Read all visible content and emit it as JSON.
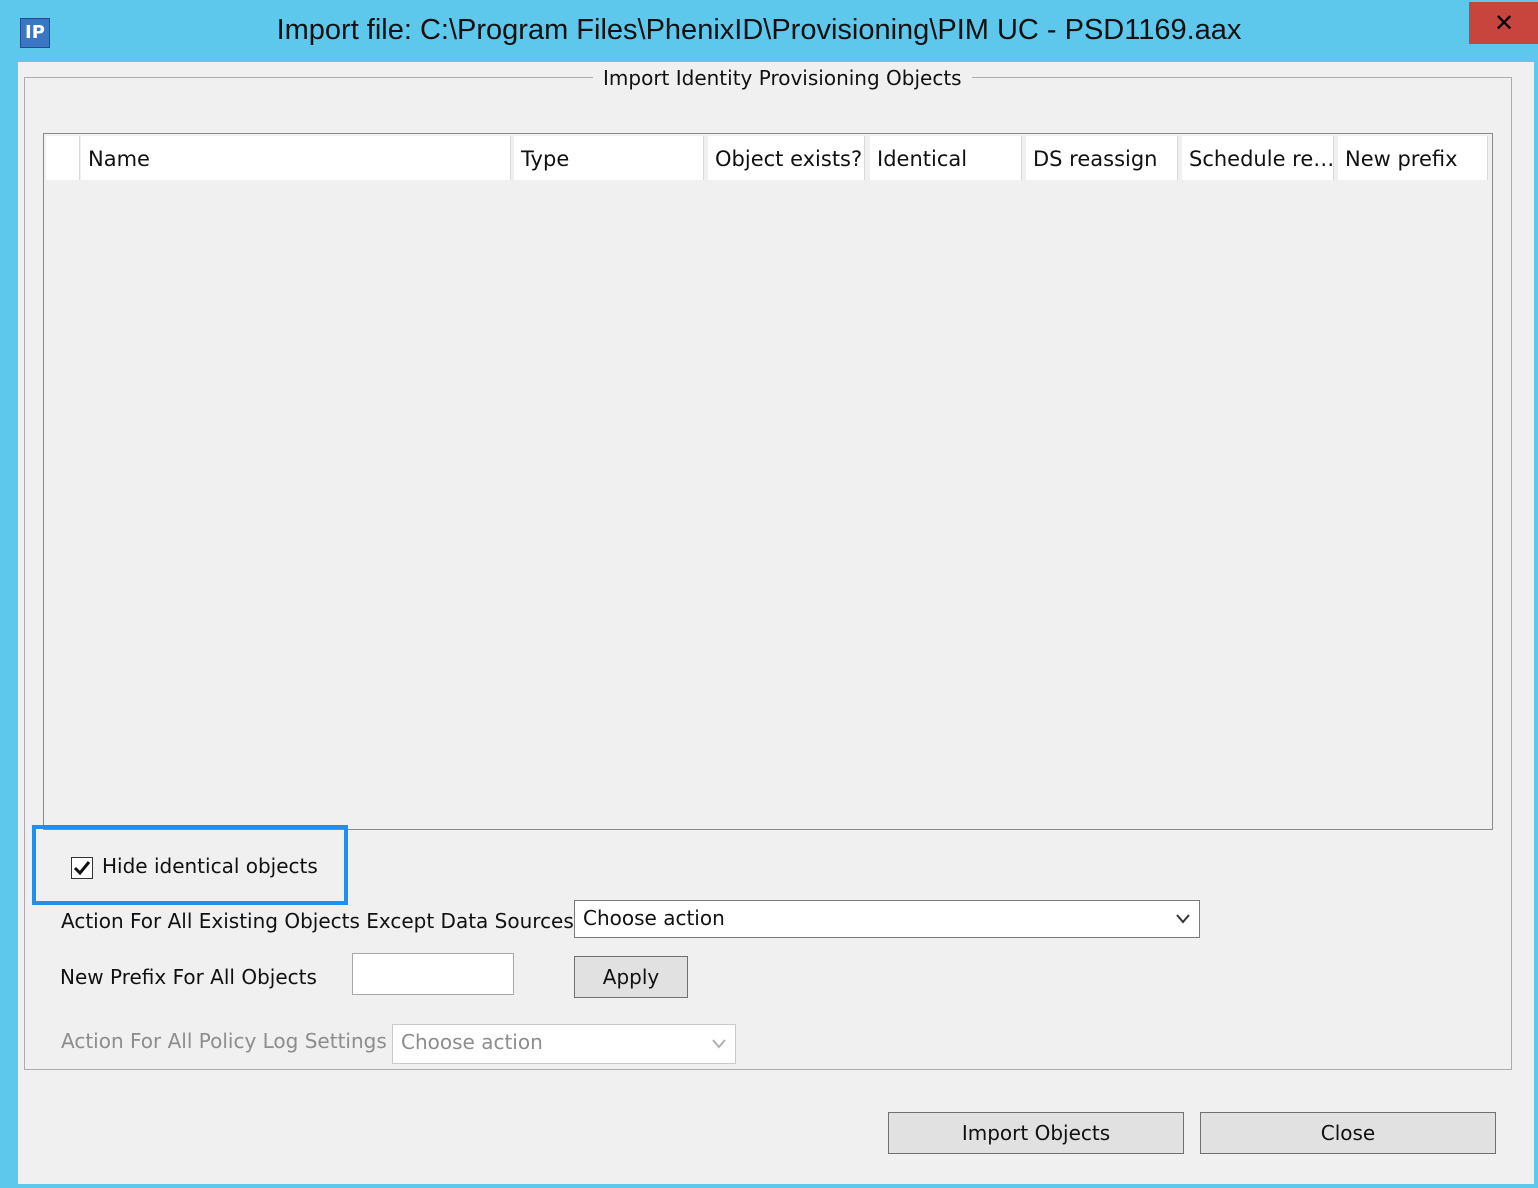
{
  "window": {
    "title": "Import file: C:\\Program Files\\PhenixID\\Provisioning\\PIM UC - PSD1169.aax",
    "app_icon_text": "IP",
    "close_glyph": "✕",
    "titlebar_color": "#5ec7ec",
    "close_color": "#c7453d"
  },
  "group": {
    "title": "Import Identity Provisioning Objects"
  },
  "table": {
    "columns": [
      "",
      "Name",
      "Type",
      "Object exists?",
      "Identical",
      "DS reassign",
      "Schedule re…",
      "New prefix"
    ],
    "rows": []
  },
  "options": {
    "hide_identical_label": "Hide identical objects",
    "hide_identical_checked": true,
    "highlight_color": "#1f8ff0",
    "action_existing_label": "Action For All Existing Objects Except Data Sources",
    "action_existing_value": "Choose action",
    "prefix_label": "New Prefix For All Objects",
    "prefix_value": "",
    "apply_label": "Apply",
    "policy_log_label": "Action For All Policy Log Settings",
    "policy_log_value": "Choose action"
  },
  "footer": {
    "import_label": "Import Objects",
    "close_label": "Close"
  }
}
